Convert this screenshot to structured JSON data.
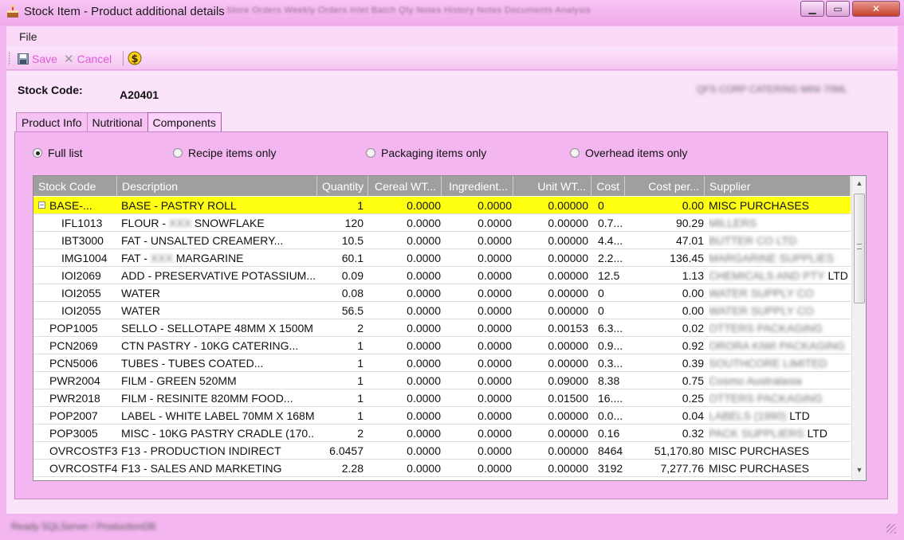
{
  "window": {
    "title": "Stock Item - Product additional details",
    "background_tabs": "Store   Orders   Weekly Orders   Inlet   Batch Qty   Notes   History Notes   Documents   Analysis"
  },
  "menu": {
    "file": "File"
  },
  "toolbar": {
    "save": "Save",
    "cancel": "Cancel"
  },
  "header": {
    "stock_code_label": "Stock Code:",
    "stock_code_value": "A20401",
    "description": "QFS CORP CATERING MINI 70ML"
  },
  "tabs": [
    {
      "label": "Product Info"
    },
    {
      "label": "Nutritional"
    },
    {
      "label": "Components"
    }
  ],
  "radios": [
    {
      "label": "Full list",
      "checked": true
    },
    {
      "label": "Recipe items only",
      "checked": false
    },
    {
      "label": "Packaging items only",
      "checked": false
    },
    {
      "label": "Overhead items only",
      "checked": false
    }
  ],
  "grid": {
    "columns": [
      "Stock Code",
      "Description",
      "Quantity",
      "Cereal WT...",
      "Ingredient...",
      "Unit WT...",
      "Cost",
      "Cost per...",
      "Supplier"
    ],
    "rows": [
      {
        "code": "BASE-...",
        "desc": "BASE - PASTRY ROLL",
        "qty": "1",
        "cereal": "0.0000",
        "ingr": "0.0000",
        "unit": "0.00000",
        "cost": "0",
        "costper": "0.00",
        "supplier": "MISC PURCHASES",
        "selected": true,
        "expander": "−"
      },
      {
        "code": "IFL1013",
        "desc": "FLOUR - ",
        "desc_blur": "XXX",
        "desc2": " SNOWFLAKE",
        "qty": "120",
        "cereal": "0.0000",
        "ingr": "0.0000",
        "unit": "0.00000",
        "cost": "0.7...",
        "costper": "90.29",
        "supplier_blur": "MILLERS",
        "child": true
      },
      {
        "code": "IBT3000",
        "desc": "FAT - UNSALTED CREAMERY...",
        "qty": "10.5",
        "cereal": "0.0000",
        "ingr": "0.0000",
        "unit": "0.00000",
        "cost": "4.4...",
        "costper": "47.01",
        "supplier_blur": "BUTTER CO LTD",
        "child": true
      },
      {
        "code": "IMG1004",
        "desc": "FAT - ",
        "desc_blur": "XXX",
        "desc2": " MARGARINE",
        "qty": "60.1",
        "cereal": "0.0000",
        "ingr": "0.0000",
        "unit": "0.00000",
        "cost": "2.2...",
        "costper": "136.45",
        "supplier_blur": "MARGARINE SUPPLIES",
        "child": true
      },
      {
        "code": "IOI2069",
        "desc": "ADD - PRESERVATIVE POTASSIUM...",
        "qty": "0.09",
        "cereal": "0.0000",
        "ingr": "0.0000",
        "unit": "0.00000",
        "cost": "12.5",
        "costper": "1.13",
        "supplier_blur": "CHEMICALS AND PTY",
        "supplier_suffix": "LTD",
        "child": true
      },
      {
        "code": "IOI2055",
        "desc": "WATER",
        "qty": "0.08",
        "cereal": "0.0000",
        "ingr": "0.0000",
        "unit": "0.00000",
        "cost": "0",
        "costper": "0.00",
        "supplier_blur": "WATER SUPPLY CO",
        "child": true
      },
      {
        "code": "IOI2055",
        "desc": "WATER",
        "qty": "56.5",
        "cereal": "0.0000",
        "ingr": "0.0000",
        "unit": "0.00000",
        "cost": "0",
        "costper": "0.00",
        "supplier_blur": "WATER SUPPLY CO",
        "child": true
      },
      {
        "code": "POP1005",
        "desc": "SELLO - SELLOTAPE 48MM X 1500M",
        "qty": "2",
        "cereal": "0.0000",
        "ingr": "0.0000",
        "unit": "0.00153",
        "cost": "6.3...",
        "costper": "0.02",
        "supplier_blur": "OTTERS PACKAGING"
      },
      {
        "code": "PCN2069",
        "desc": "CTN PASTRY - 10KG CATERING...",
        "qty": "1",
        "cereal": "0.0000",
        "ingr": "0.0000",
        "unit": "0.00000",
        "cost": "0.9...",
        "costper": "0.92",
        "supplier_blur": "ORORA KIWI PACKAGING"
      },
      {
        "code": "PCN5006",
        "desc": "TUBES - TUBES COATED...",
        "qty": "1",
        "cereal": "0.0000",
        "ingr": "0.0000",
        "unit": "0.00000",
        "cost": "0.3...",
        "costper": "0.39",
        "supplier_blur": "SOUTHCORE LIMITED"
      },
      {
        "code": "PWR2004",
        "desc": "FILM - GREEN 520MM",
        "qty": "1",
        "cereal": "0.0000",
        "ingr": "0.0000",
        "unit": "0.09000",
        "cost": "8.38",
        "costper": "0.75",
        "supplier_blur": "Cosmo Australasia"
      },
      {
        "code": "PWR2018",
        "desc": "FILM - RESINITE 820MM FOOD...",
        "qty": "1",
        "cereal": "0.0000",
        "ingr": "0.0000",
        "unit": "0.01500",
        "cost": "16....",
        "costper": "0.25",
        "supplier_blur": "OTTERS PACKAGING"
      },
      {
        "code": "POP2007",
        "desc": "LABEL - WHITE LABEL 70MM X 168MM",
        "qty": "1",
        "cereal": "0.0000",
        "ingr": "0.0000",
        "unit": "0.00000",
        "cost": "0.0...",
        "costper": "0.04",
        "supplier_blur": "LABELS (1990)",
        "supplier_suffix": "LTD"
      },
      {
        "code": "POP3005",
        "desc": "MISC - 10KG PASTRY CRADLE (170...",
        "qty": "2",
        "cereal": "0.0000",
        "ingr": "0.0000",
        "unit": "0.00000",
        "cost": "0.16",
        "costper": "0.32",
        "supplier_blur": "PACK SUPPLIERS",
        "supplier_suffix": "LTD"
      },
      {
        "code": "OVRCOSTF3",
        "desc": "F13 - PRODUCTION INDIRECT",
        "qty": "6.0457",
        "cereal": "0.0000",
        "ingr": "0.0000",
        "unit": "0.00000",
        "cost": "8464",
        "costper": "51,170.80",
        "supplier": "MISC PURCHASES"
      },
      {
        "code": "OVRCOSTF4",
        "desc": "F13 - SALES AND MARKETING",
        "qty": "2.28",
        "cereal": "0.0000",
        "ingr": "0.0000",
        "unit": "0.00000",
        "cost": "3192",
        "costper": "7,277.76",
        "supplier": "MISC PURCHASES"
      }
    ]
  },
  "status": {
    "text": "Ready  SQLServer / ProductionDB"
  }
}
